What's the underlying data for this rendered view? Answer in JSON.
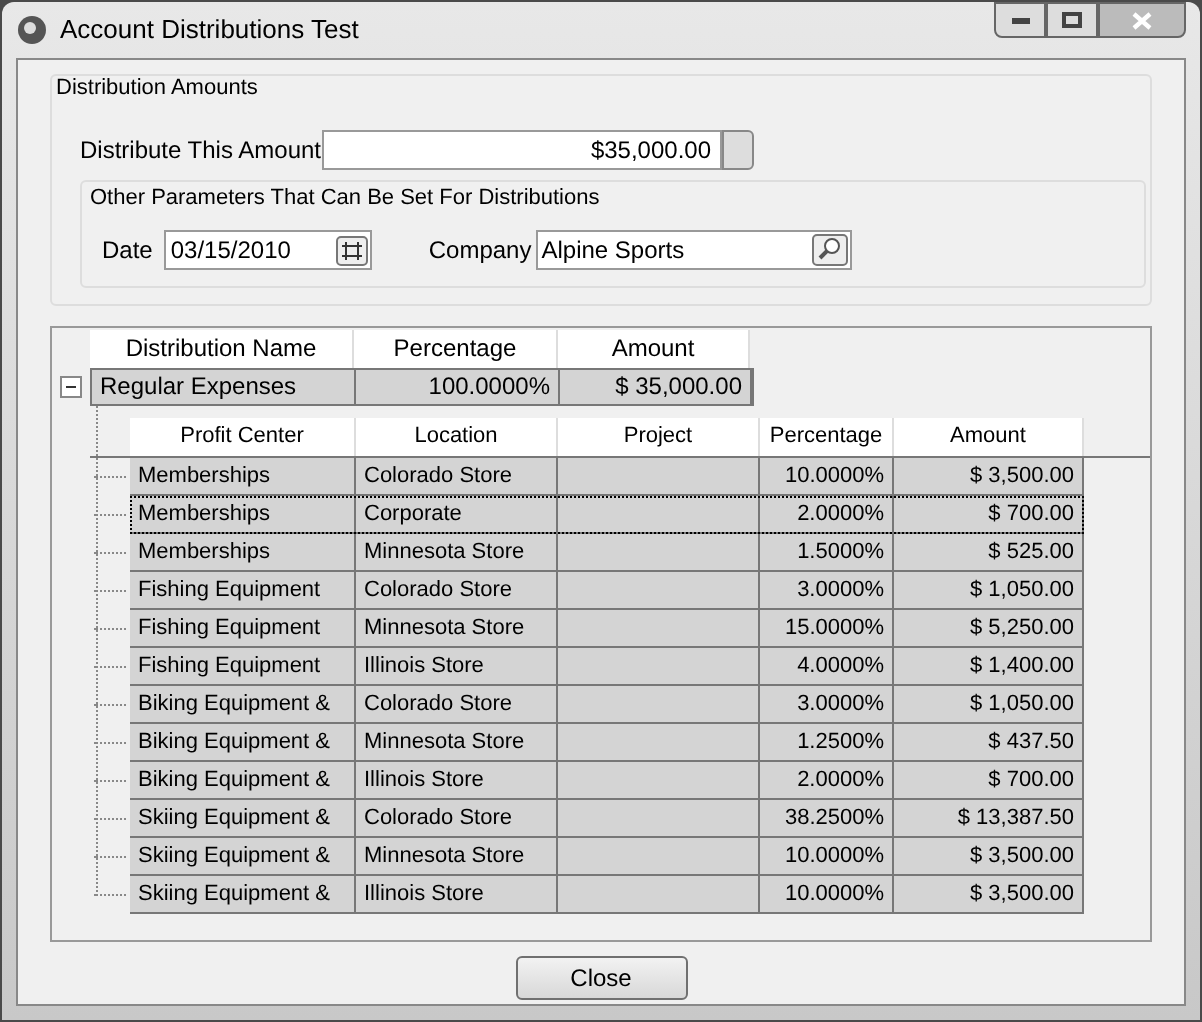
{
  "window": {
    "title": "Account Distributions Test"
  },
  "distribution_amounts": {
    "title": "Distribution Amounts",
    "amount_label": "Distribute This Amount",
    "amount_value": "$35,000.00"
  },
  "other_parameters": {
    "title": "Other Parameters That Can Be Set For Distributions",
    "date_label": "Date",
    "date_value": "03/15/2010",
    "company_label": "Company",
    "company_value": "Alpine Sports"
  },
  "distributions": {
    "columns": [
      "Distribution Name",
      "Percentage",
      "Amount"
    ],
    "rows": [
      {
        "name": "Regular Expenses",
        "percentage": "100.0000%",
        "amount": "$ 35,000.00",
        "expanded": true,
        "detail_columns": [
          "Profit Center",
          "Location",
          "Project",
          "Percentage",
          "Amount"
        ],
        "details": [
          {
            "profit_center": "Memberships",
            "location": "Colorado Store",
            "percentage": "10.0000%",
            "amount": "$ 3,500.00",
            "selected": false
          },
          {
            "profit_center": "Memberships",
            "location": "Corporate",
            "percentage": "2.0000%",
            "amount": "$ 700.00",
            "selected": true
          },
          {
            "profit_center": "Memberships",
            "location": "Minnesota Store",
            "percentage": "1.5000%",
            "amount": "$ 525.00",
            "selected": false
          },
          {
            "profit_center": "Fishing Equipment",
            "location": "Colorado Store",
            "percentage": "3.0000%",
            "amount": "$ 1,050.00",
            "selected": false
          },
          {
            "profit_center": "Fishing Equipment",
            "location": "Minnesota Store",
            "percentage": "15.0000%",
            "amount": "$ 5,250.00",
            "selected": false
          },
          {
            "profit_center": "Fishing Equipment",
            "location": "Illinois Store",
            "percentage": "4.0000%",
            "amount": "$ 1,400.00",
            "selected": false
          },
          {
            "profit_center": "Biking Equipment &",
            "location": "Colorado Store",
            "percentage": "3.0000%",
            "amount": "$ 1,050.00",
            "selected": false
          },
          {
            "profit_center": "Biking Equipment &",
            "location": "Minnesota Store",
            "percentage": "1.2500%",
            "amount": "$ 437.50",
            "selected": false
          },
          {
            "profit_center": "Biking Equipment &",
            "location": "Illinois Store",
            "percentage": "2.0000%",
            "amount": "$ 700.00",
            "selected": false
          },
          {
            "profit_center": "Skiing Equipment &",
            "location": "Colorado Store",
            "percentage": "38.2500%",
            "amount": "$ 13,387.50",
            "selected": false
          },
          {
            "profit_center": "Skiing Equipment &",
            "location": "Minnesota Store",
            "percentage": "10.0000%",
            "amount": "$ 3,500.00",
            "selected": false
          },
          {
            "profit_center": "Skiing Equipment &",
            "location": "Illinois Store",
            "percentage": "10.0000%",
            "amount": "$ 3,500.00",
            "selected": false
          }
        ]
      }
    ]
  },
  "buttons": [
    {
      "label": "Close"
    }
  ]
}
